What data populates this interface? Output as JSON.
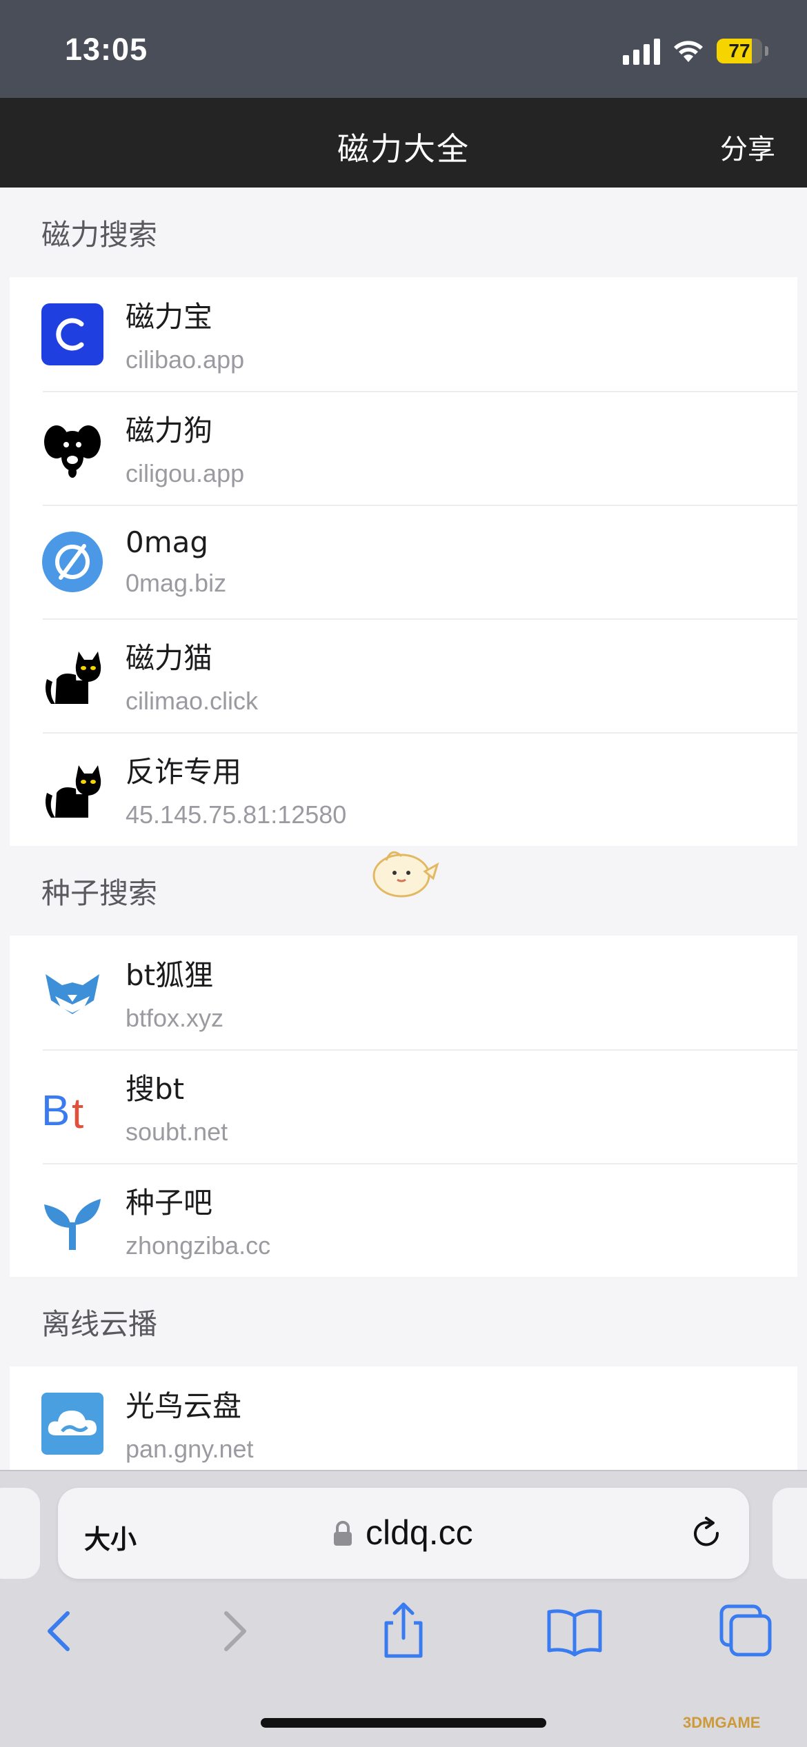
{
  "status_bar": {
    "time": "13:05",
    "battery": "77"
  },
  "header": {
    "title": "磁力大全",
    "share_label": "分享"
  },
  "sections": [
    {
      "title": "磁力搜索",
      "items": [
        {
          "name": "磁力宝",
          "url": "cilibao.app",
          "icon": "cilibao-logo-icon"
        },
        {
          "name": "磁力狗",
          "url": "ciligou.app",
          "icon": "dog-icon"
        },
        {
          "name": "0mag",
          "url": "0mag.biz",
          "icon": "empty-set-icon"
        },
        {
          "name": "磁力猫",
          "url": "cilimao.click",
          "icon": "cat-icon"
        },
        {
          "name": "反诈专用",
          "url": "45.145.75.81:12580",
          "icon": "cat-icon"
        }
      ]
    },
    {
      "title": "种子搜索",
      "items": [
        {
          "name": "bt狐狸",
          "url": "btfox.xyz",
          "icon": "fox-icon"
        },
        {
          "name": "搜bt",
          "url": "soubt.net",
          "icon": "bt-logo-icon"
        },
        {
          "name": "种子吧",
          "url": "zhongziba.cc",
          "icon": "sprout-icon"
        }
      ]
    },
    {
      "title": "离线云播",
      "items": [
        {
          "name": "光鸟云盘",
          "url": "pan.gny.net",
          "icon": "cloud-icon"
        }
      ]
    }
  ],
  "browser": {
    "text_size_label": "大小",
    "address": "cldq.cc"
  },
  "watermark": "3DMGAME",
  "colors": {
    "navbar": "#242424",
    "status_bar": "#4a4e58",
    "accent": "#3a7cf0",
    "cilibao_blue": "#1f3fe0"
  }
}
